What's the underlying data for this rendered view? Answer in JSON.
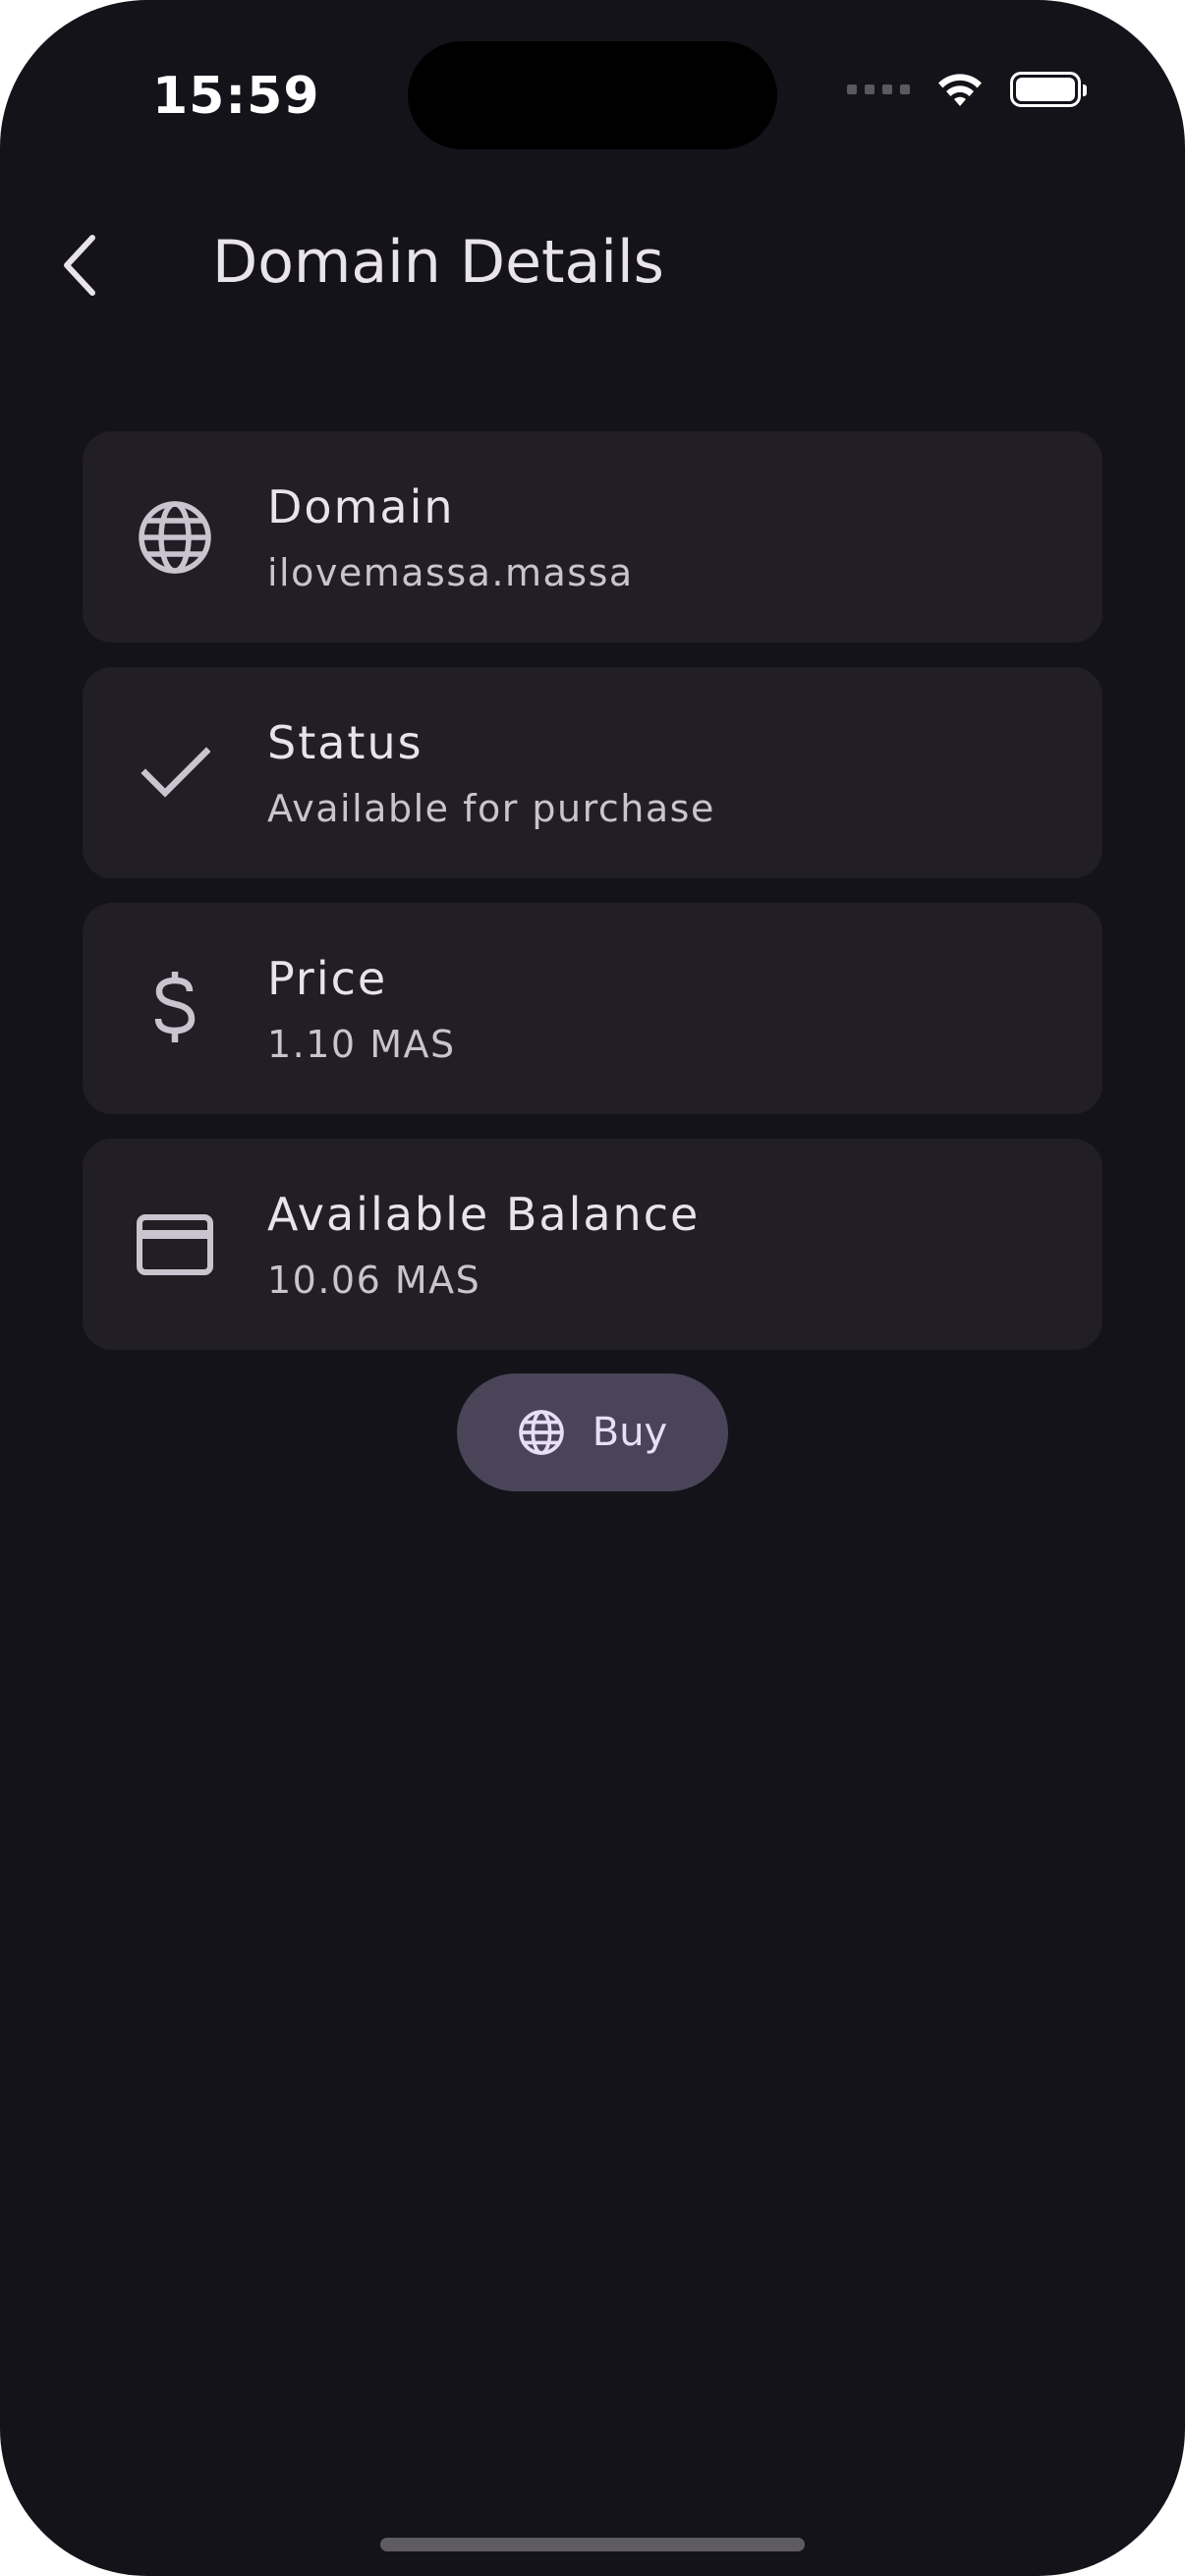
{
  "status_bar": {
    "time": "15:59"
  },
  "app_bar": {
    "title": "Domain Details",
    "back_icon": "chevron-left-icon"
  },
  "details": [
    {
      "icon": "globe-icon",
      "label": "Domain",
      "value": "ilovemassa.massa"
    },
    {
      "icon": "check-icon",
      "label": "Status",
      "value": "Available for purchase"
    },
    {
      "icon": "dollar-icon",
      "label": "Price",
      "value": "1.10 MAS"
    },
    {
      "icon": "credit-card-icon",
      "label": "Available Balance",
      "value": "10.06 MAS"
    }
  ],
  "buy_button": {
    "label": "Buy",
    "icon": "globe-icon"
  },
  "colors": {
    "background": "#15131a",
    "card": "#211f25",
    "button": "#4a4459",
    "text_primary": "#e8e3ec",
    "text_secondary": "#c9c4cf"
  }
}
